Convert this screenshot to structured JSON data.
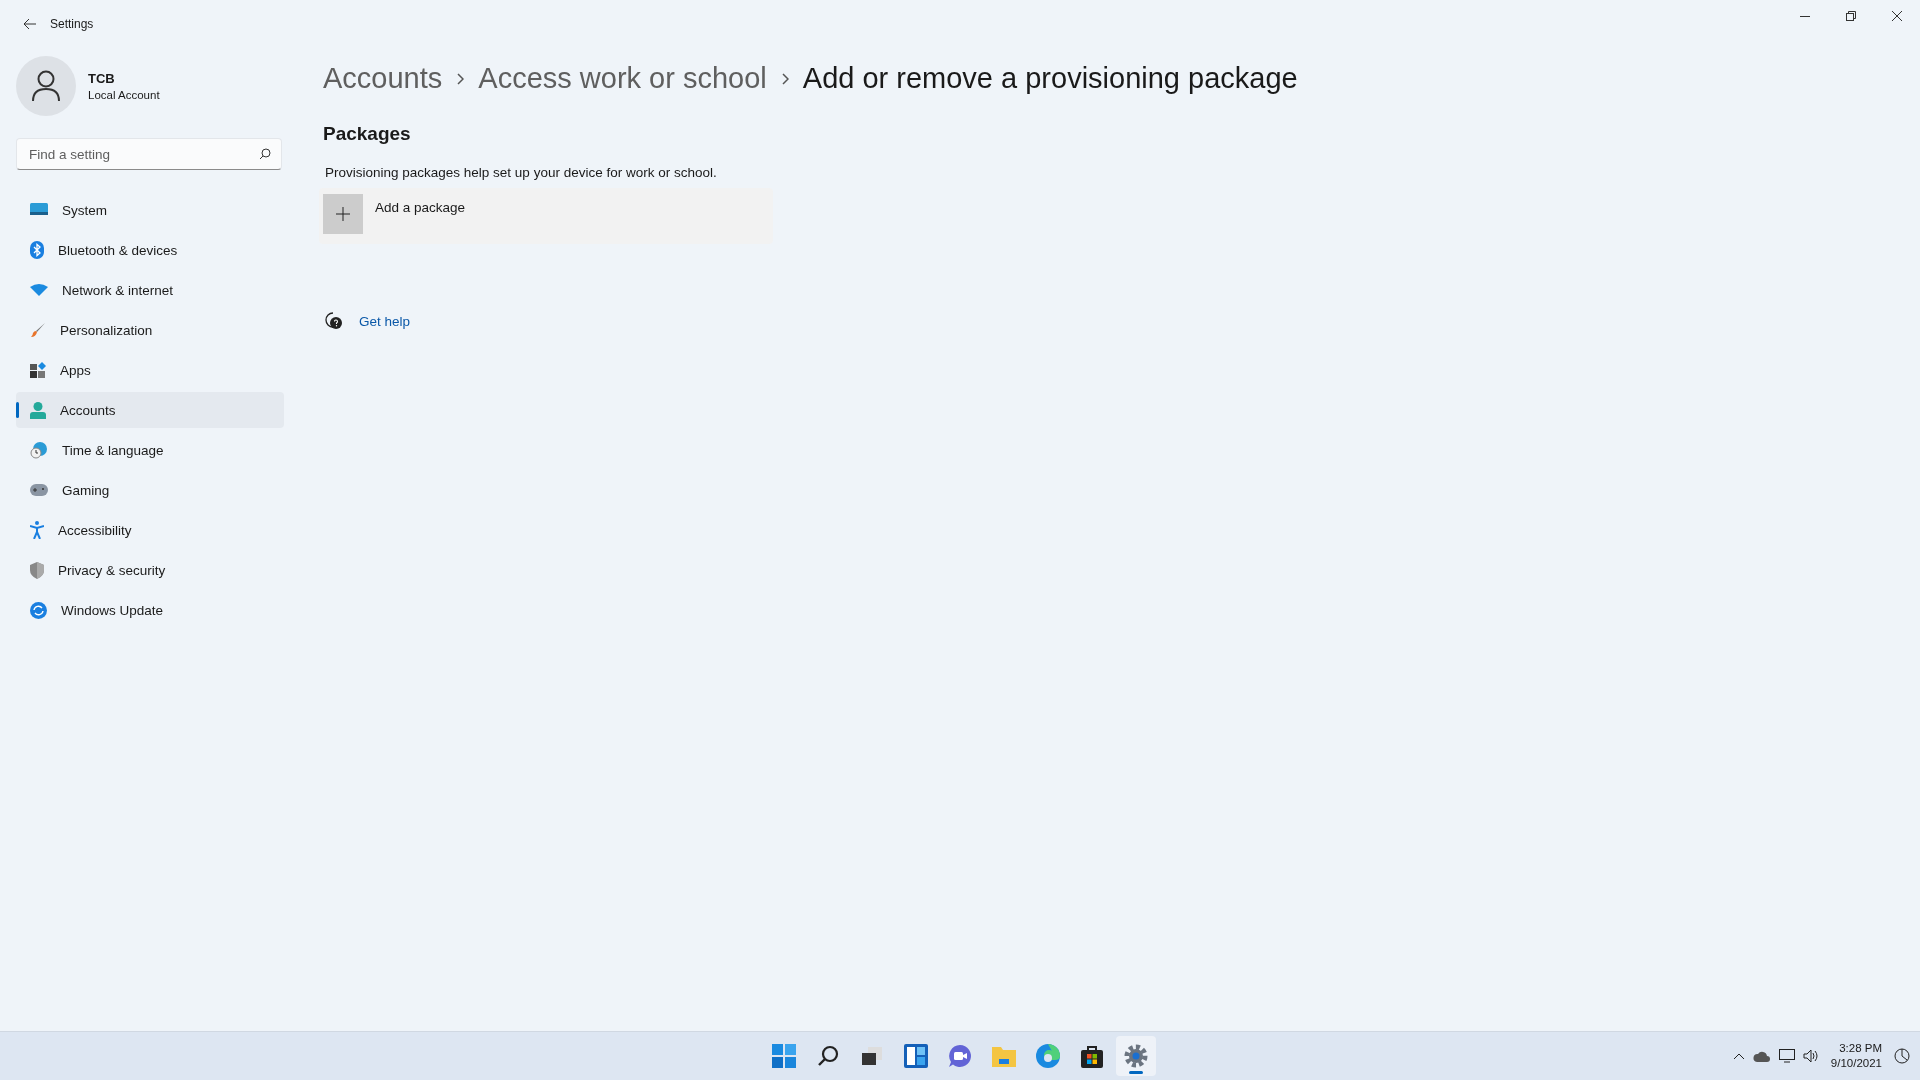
{
  "window": {
    "title": "Settings"
  },
  "user": {
    "name": "TCB",
    "account_type": "Local Account"
  },
  "search": {
    "placeholder": "Find a setting"
  },
  "sidebar": {
    "items": [
      {
        "label": "System",
        "kind": "system",
        "selected": false
      },
      {
        "label": "Bluetooth & devices",
        "kind": "bluetooth",
        "selected": false
      },
      {
        "label": "Network & internet",
        "kind": "network",
        "selected": false
      },
      {
        "label": "Personalization",
        "kind": "personalization",
        "selected": false
      },
      {
        "label": "Apps",
        "kind": "apps",
        "selected": false
      },
      {
        "label": "Accounts",
        "kind": "accounts",
        "selected": true
      },
      {
        "label": "Time & language",
        "kind": "time",
        "selected": false
      },
      {
        "label": "Gaming",
        "kind": "gaming",
        "selected": false
      },
      {
        "label": "Accessibility",
        "kind": "accessibility",
        "selected": false
      },
      {
        "label": "Privacy & security",
        "kind": "privacy",
        "selected": false
      },
      {
        "label": "Windows Update",
        "kind": "update",
        "selected": false
      }
    ]
  },
  "breadcrumb": [
    "Accounts",
    "Access work or school",
    "Add or remove a provisioning package"
  ],
  "section": {
    "title": "Packages",
    "description": "Provisioning packages help set up your device for work or school.",
    "add_button": "Add a package"
  },
  "help_link": "Get help",
  "taskbar": {
    "apps": [
      {
        "kind": "start",
        "selected": false
      },
      {
        "kind": "search",
        "selected": false
      },
      {
        "kind": "taskview",
        "selected": false
      },
      {
        "kind": "widgets",
        "selected": false
      },
      {
        "kind": "chat",
        "selected": false
      },
      {
        "kind": "explorer",
        "selected": false
      },
      {
        "kind": "edge",
        "selected": false
      },
      {
        "kind": "store",
        "selected": false
      },
      {
        "kind": "settings",
        "selected": true
      }
    ],
    "time": "3:28 PM",
    "date": "9/10/2021"
  }
}
